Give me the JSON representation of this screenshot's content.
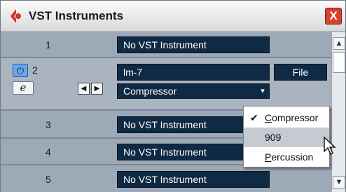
{
  "window": {
    "title": "VST Instruments",
    "close_label": "X"
  },
  "rows": [
    {
      "number": "1",
      "instrument": "No VST Instrument"
    },
    {
      "number": "2",
      "instrument": "lm-7",
      "file_label": "File",
      "preset": "Compressor",
      "edit_glyph": "e",
      "power_glyph": "⏻",
      "prev_glyph": "◀",
      "next_glyph": "▶",
      "dropdown_glyph": "▾"
    },
    {
      "number": "3",
      "instrument": "No VST Instrument"
    },
    {
      "number": "4",
      "instrument": "No VST Instrument"
    },
    {
      "number": "5",
      "instrument": "No VST Instrument"
    }
  ],
  "menu": {
    "items": [
      {
        "first": "C",
        "rest": "ompressor",
        "checked": true,
        "check_glyph": "✔"
      },
      {
        "first": "",
        "rest": "909",
        "highlighted": true
      },
      {
        "first": "P",
        "rest": "ercussion"
      }
    ]
  },
  "scrollbar": {
    "up_glyph": "▲",
    "down_glyph": "▼"
  },
  "icons": {
    "logo": "cubase-logo-icon",
    "cursor": "mouse-pointer-icon"
  },
  "colors": {
    "slot_bg": "#0f2a44",
    "close_red": "#d8412f",
    "row_bg": "#9ea9b7",
    "power_blue": "#6aa6e8"
  }
}
